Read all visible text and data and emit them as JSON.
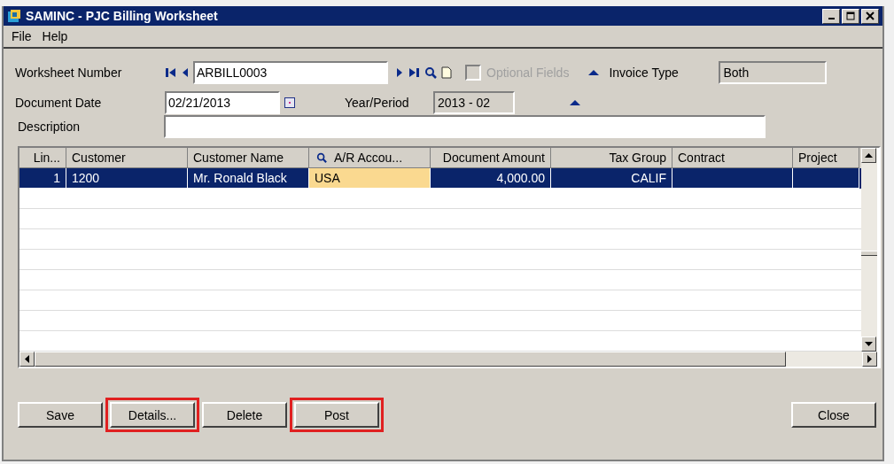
{
  "window": {
    "title": "SAMINC - PJC Billing Worksheet"
  },
  "menu": [
    "File",
    "Help"
  ],
  "worksheet_number": {
    "label": "Worksheet Number",
    "value": "ARBILL0003"
  },
  "optional_fields": {
    "label": "Optional Fields",
    "checked": false,
    "disabled": true
  },
  "invoice_type": {
    "label": "Invoice Type",
    "value": "Both"
  },
  "document_date": {
    "label": "Document Date",
    "value": "02/21/2013"
  },
  "year_period": {
    "label": "Year/Period",
    "value": "2013 - 02"
  },
  "description": {
    "label": "Description"
  },
  "table": {
    "columns": [
      {
        "label": "Lin...",
        "kind": "number"
      },
      {
        "label": "Customer",
        "kind": "text"
      },
      {
        "label": "Customer Name",
        "kind": "text"
      },
      {
        "label": "A/R Accou...",
        "kind": "lookup"
      },
      {
        "label": "Document Amount",
        "kind": "number"
      },
      {
        "label": "Tax Group",
        "kind": "number"
      },
      {
        "label": "Contract",
        "kind": "text"
      },
      {
        "label": "Project",
        "kind": "text"
      }
    ],
    "rows": [
      {
        "selected": true,
        "cells": [
          {
            "text": "1",
            "focused": false
          },
          {
            "text": "1200",
            "focused": false
          },
          {
            "text": "Mr. Ronald Black",
            "focused": false
          },
          {
            "text": "USA",
            "focused": true
          },
          {
            "text": "4,000.00",
            "focused": false
          },
          {
            "text": "CALIF",
            "focused": false
          }
        ]
      }
    ]
  },
  "buttons": [
    {
      "label": "Save",
      "highlighted": false
    },
    {
      "label": "Details...",
      "highlighted": true
    },
    {
      "label": "Delete",
      "highlighted": false
    },
    {
      "label": "Post",
      "highlighted": true
    },
    {
      "label": "Close",
      "highlighted": false
    }
  ]
}
